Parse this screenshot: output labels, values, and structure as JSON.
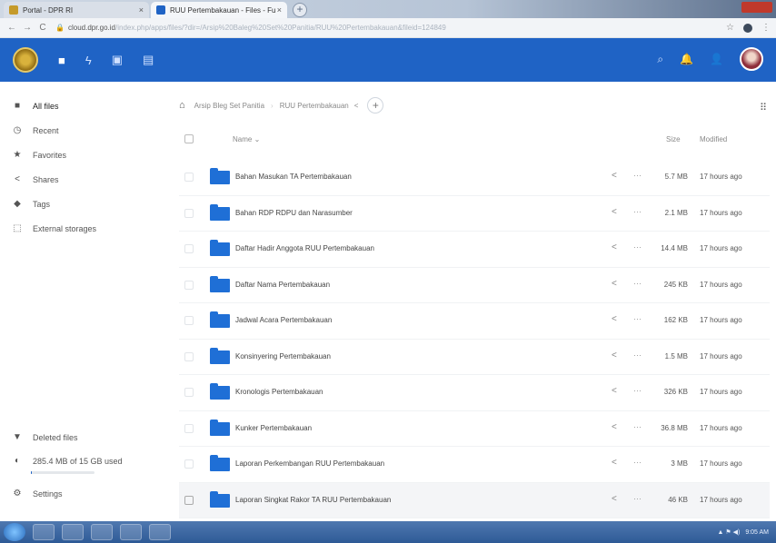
{
  "browser": {
    "tabs": [
      {
        "title": "Portal - DPR RI",
        "close": "×",
        "favicon_color": "#c59a2a"
      },
      {
        "title": "RUU Pertembakauan - Files - Fu",
        "close": "×",
        "favicon_color": "#1f63c5"
      }
    ],
    "new_tab": "+",
    "back": "←",
    "forward": "→",
    "reload": "C",
    "lock": "🔒",
    "url_host": "cloud.dpr.go.id",
    "url_rest": "/index.php/apps/files/?dir=/Arsip%20Baleg%20Set%20Panitia/RUU%20Pertembakauan&fileid=124849",
    "star": "☆",
    "menu": "⋮"
  },
  "header": {
    "nav_icons": [
      "■",
      "ϟ",
      "▣",
      "▤"
    ],
    "search": "⌕",
    "notifications": "🔔",
    "contacts": "👤"
  },
  "sidebar": {
    "items": [
      {
        "icon": "■",
        "label": "All files",
        "active": true
      },
      {
        "icon": "◷",
        "label": "Recent"
      },
      {
        "icon": "★",
        "label": "Favorites"
      },
      {
        "icon": "<",
        "label": "Shares"
      },
      {
        "icon": "◆",
        "label": "Tags"
      },
      {
        "icon": "⬚",
        "label": "External storages"
      }
    ],
    "deleted": {
      "icon": "▼",
      "label": "Deleted files"
    },
    "quota": {
      "icon": "◐",
      "label": "285.4 MB of 15 GB used",
      "fraction": 0.02
    },
    "settings": {
      "icon": "⚙",
      "label": "Settings"
    }
  },
  "breadcrumb": {
    "home": "⌂",
    "items": [
      "Arsip Bleg Set Panitia",
      "RUU Pertembakauan"
    ],
    "separator": "›",
    "share": "<",
    "add": "+"
  },
  "view_toggle": "⠿",
  "table": {
    "headers": {
      "name": "Name ⌄",
      "size": "Size",
      "modified": "Modified"
    },
    "share_icon": "<",
    "more_icon": "···",
    "rows": [
      {
        "name": "Bahan Masukan TA Pertembakauan",
        "size": "5.7 MB",
        "modified": "17 hours ago"
      },
      {
        "name": "Bahan RDP RDPU dan Narasumber",
        "size": "2.1 MB",
        "modified": "17 hours ago"
      },
      {
        "name": "Daftar Hadir Anggota RUU Pertembakauan",
        "size": "14.4 MB",
        "modified": "17 hours ago"
      },
      {
        "name": "Daftar Nama Pertembakauan",
        "size": "245 KB",
        "modified": "17 hours ago"
      },
      {
        "name": "Jadwal Acara Pertembakauan",
        "size": "162 KB",
        "modified": "17 hours ago"
      },
      {
        "name": "Konsinyering Pertembakauan",
        "size": "1.5 MB",
        "modified": "17 hours ago"
      },
      {
        "name": "Kronologis Pertembakauan",
        "size": "326 KB",
        "modified": "17 hours ago"
      },
      {
        "name": "Kunker Pertembakauan",
        "size": "36.8 MB",
        "modified": "17 hours ago"
      },
      {
        "name": "Laporan Perkembangan RUU Pertembakauan",
        "size": "3 MB",
        "modified": "17 hours ago"
      },
      {
        "name": "Laporan Singkat Rakor TA RUU Pertembakauan",
        "size": "46 KB",
        "modified": "17 hours ago"
      }
    ]
  },
  "taskbar": {
    "clock": "9:05 AM",
    "tray_icons": "▲ ⚑ ◀)"
  },
  "colors": {
    "accent": "#1f63c5",
    "folder": "#1f6fd6"
  }
}
